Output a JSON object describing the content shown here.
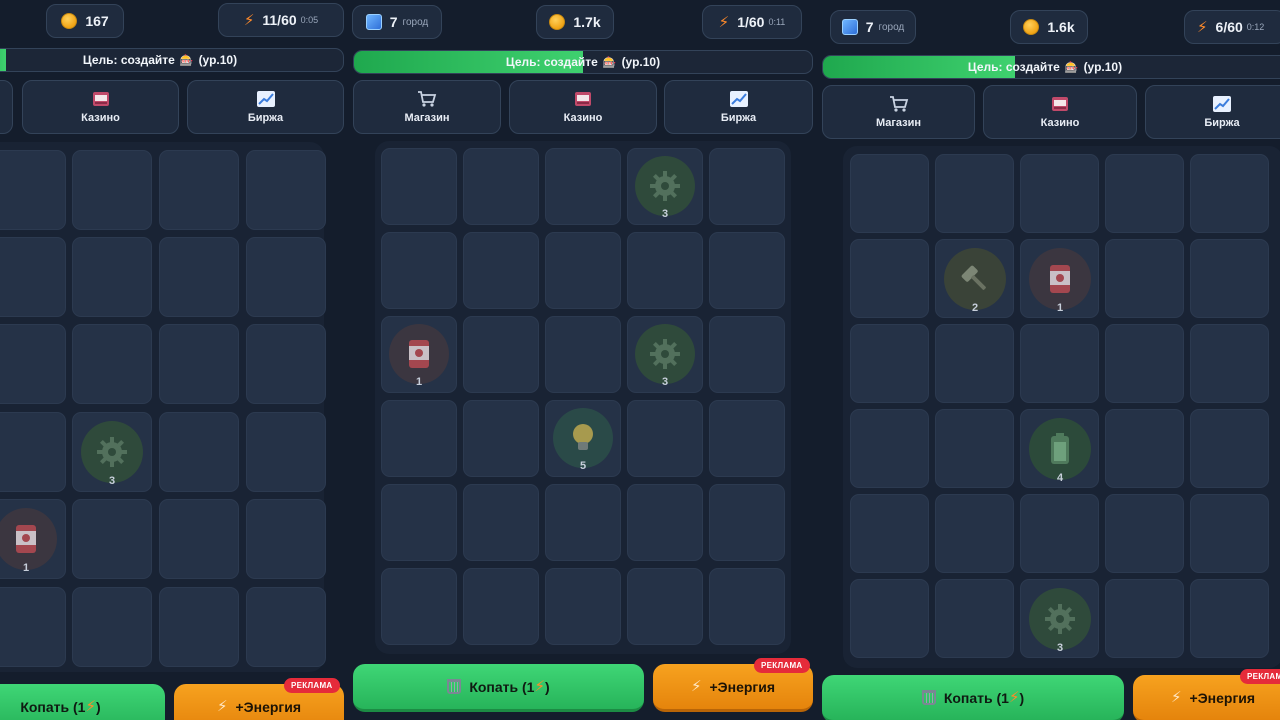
{
  "colors": {
    "background": "#141d2c",
    "accent_green": "#3fd16f",
    "accent_orange": "#f7a21f",
    "ad_red": "#e52b3a",
    "coin": "#f0a416"
  },
  "panels": [
    {
      "coins": "167",
      "energy": "11/60",
      "timer": "0:05",
      "goal": {
        "text": "Цель: создайте",
        "level": "(ур.10)",
        "progress_pct": 8
      },
      "nav": [
        {
          "label": "",
          "icon": "partial-button"
        },
        {
          "label": "Казино",
          "icon": "slot-machine-icon"
        },
        {
          "label": "Биржа",
          "icon": "chart-icon"
        }
      ],
      "actions": {
        "dig": "Копать (1",
        "dig_close": ")",
        "energy": "+Энергия",
        "ad_badge": "РЕКЛАМА"
      }
    },
    {
      "city_count": "7",
      "city_label": "город",
      "coins": "1.7k",
      "energy": "1/60",
      "timer": "0:11",
      "goal": {
        "text": "Цель: создайте",
        "level": "(ур.10)",
        "progress_pct": 50
      },
      "nav": [
        {
          "label": "Магазин",
          "icon": "cart-icon"
        },
        {
          "label": "Казино",
          "icon": "slot-machine-icon"
        },
        {
          "label": "Биржа",
          "icon": "chart-icon"
        }
      ],
      "actions": {
        "dig": "Копать (1",
        "dig_close": ")",
        "energy": "+Энергия",
        "ad_badge": "РЕКЛАМА"
      }
    },
    {
      "city_count": "7",
      "city_label": "город",
      "coins": "1.6k",
      "energy": "6/60",
      "timer": "0:12",
      "goal": {
        "text": "Цель: создайте",
        "level": "(ур.10)",
        "progress_pct": 41
      },
      "nav": [
        {
          "label": "Магазин",
          "icon": "cart-icon"
        },
        {
          "label": "Казино",
          "icon": "slot-machine-icon"
        },
        {
          "label": "Биржа",
          "icon": "chart-icon"
        }
      ],
      "actions": {
        "dig": "Копать (1",
        "dig_close": ")",
        "energy": "+Энергия",
        "ad_badge": "РЕКЛАМА"
      }
    }
  ],
  "items": {
    "panel1": [
      {
        "kind": "gear",
        "level": "3"
      },
      {
        "kind": "can",
        "level": "1"
      }
    ],
    "panel2": [
      {
        "kind": "gear",
        "level": "3"
      },
      {
        "kind": "can",
        "level": "1"
      },
      {
        "kind": "gear",
        "level": "3"
      },
      {
        "kind": "bulb",
        "level": "5"
      }
    ],
    "panel3": [
      {
        "kind": "hammer",
        "level": "2"
      },
      {
        "kind": "can",
        "level": "1"
      },
      {
        "kind": "battery",
        "level": "4"
      },
      {
        "kind": "gear",
        "level": "3"
      }
    ]
  }
}
